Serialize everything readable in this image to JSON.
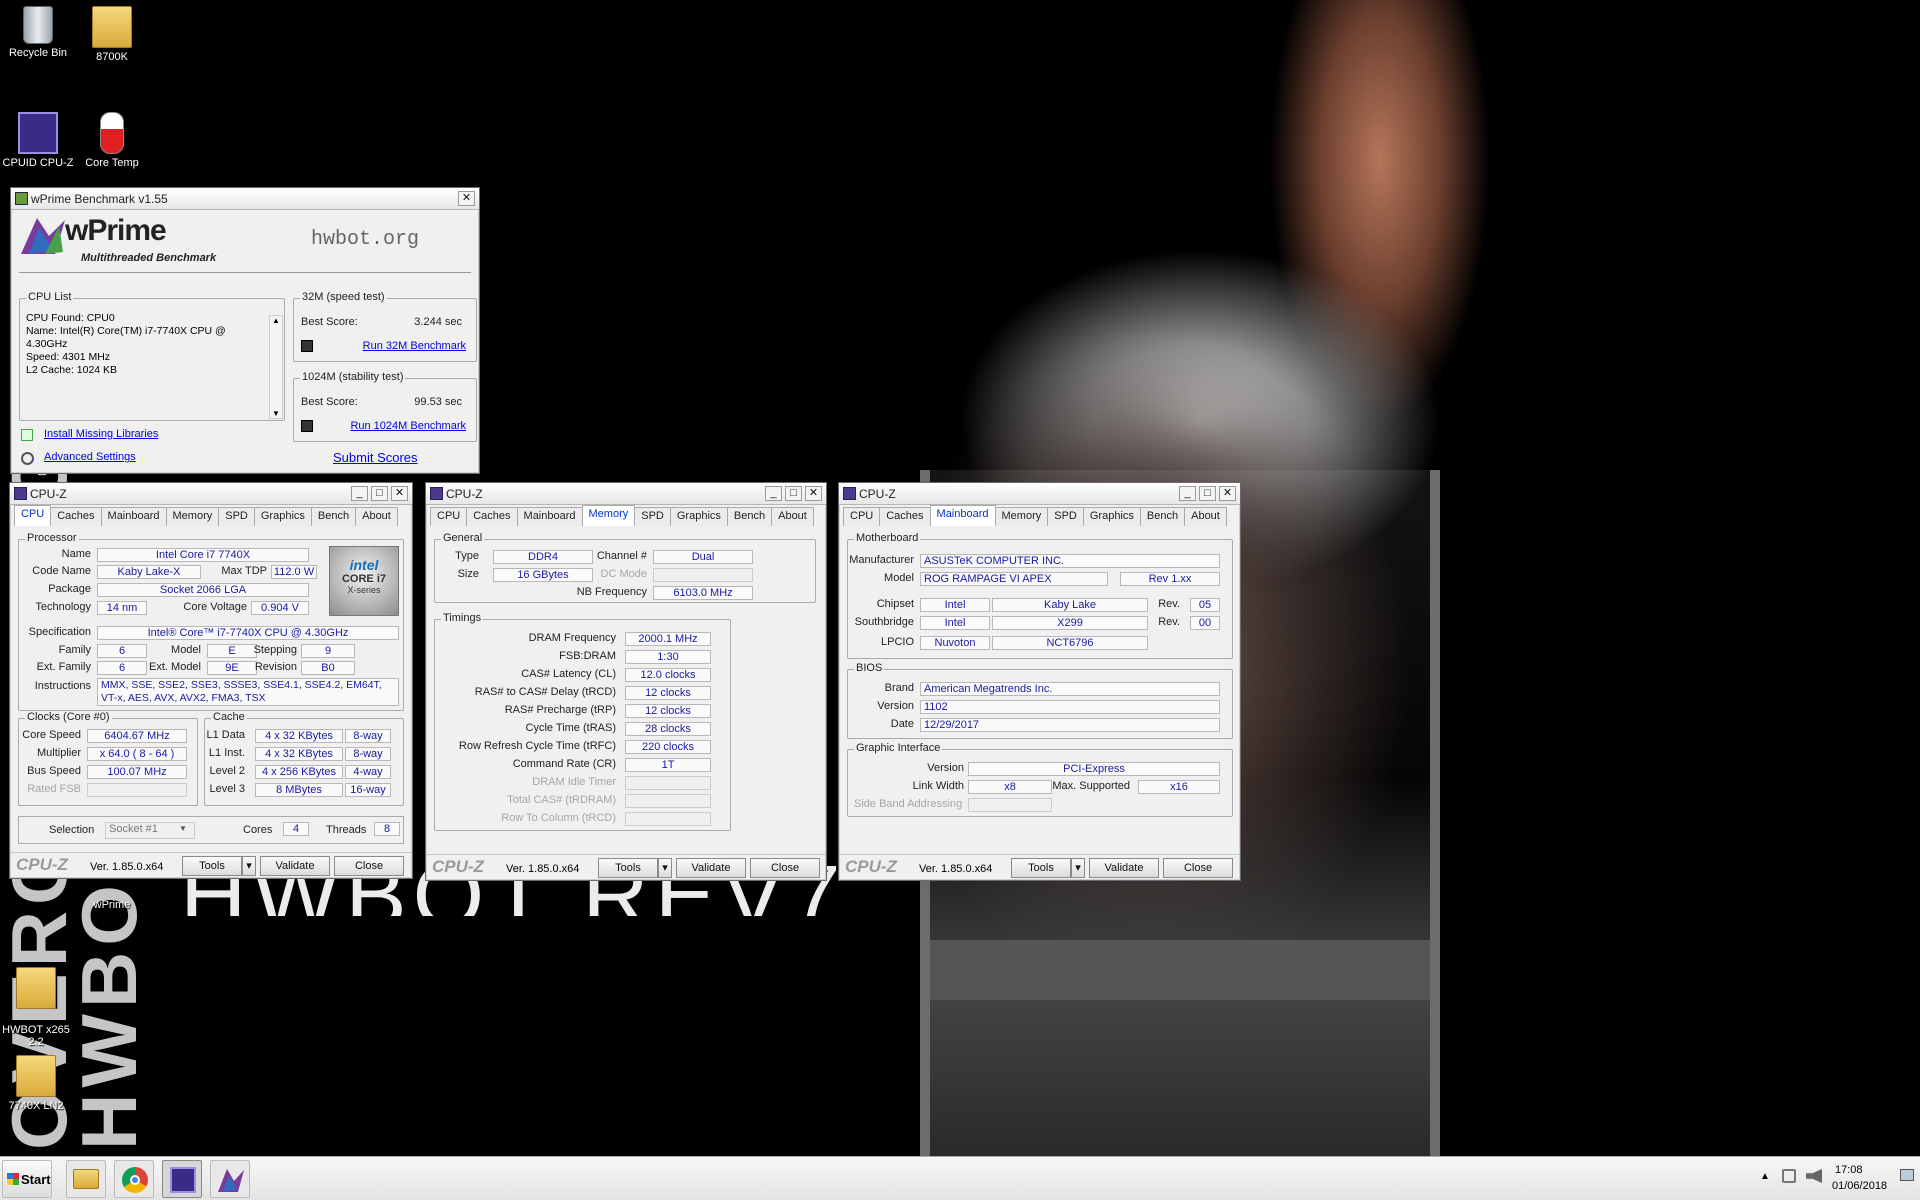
{
  "desktop": {
    "icons": [
      {
        "id": "recycle",
        "label": "Recycle Bin"
      },
      {
        "id": "f8700k",
        "label": "8700K"
      },
      {
        "id": "cpuz",
        "label": "CPUID CPU-Z"
      },
      {
        "id": "coretemp",
        "label": "Core Temp"
      },
      {
        "id": "wprime",
        "label": "wPrime"
      },
      {
        "id": "hwbot",
        "label": "HWBOT x265\n2.2"
      },
      {
        "id": "f7740x",
        "label": "7740X LN2"
      }
    ],
    "wallpaper_text": "HWBOT REV7",
    "side_text": "OVERCLOCKING HWBOT"
  },
  "wprime": {
    "title": "wPrime Benchmark v1.55",
    "logo": "wPrime",
    "logo_sub": "Multithreaded Benchmark",
    "hwbot": "hwbot.org",
    "cpu_list_label": "CPU List",
    "cpu_list_lines": [
      "CPU Found: CPU0",
      "Name:    Intel(R) Core(TM) i7-7740X CPU @",
      "4.30GHz",
      "Speed:   4301 MHz",
      "L2 Cache: 1024 KB"
    ],
    "speed_test_label": "32M (speed test)",
    "stability_test_label": "1024M (stability test)",
    "best_score_label": "Best Score:",
    "score_32m": "3.244 sec",
    "score_1024m": "99.53 sec",
    "run_32m": "Run 32M Benchmark",
    "run_1024m": "Run 1024M Benchmark",
    "install_libs": "Install Missing Libraries",
    "advanced": "Advanced Settings",
    "submit": "Submit Scores"
  },
  "cpuz_common": {
    "title": "CPU-Z",
    "tabs": [
      "CPU",
      "Caches",
      "Mainboard",
      "Memory",
      "SPD",
      "Graphics",
      "Bench",
      "About"
    ],
    "logo": "CPU-Z",
    "version": "Ver. 1.85.0.x64",
    "tools": "Tools",
    "validate": "Validate",
    "close": "Close"
  },
  "cpuz1": {
    "processor_label": "Processor",
    "name_label": "Name",
    "name": "Intel Core i7 7740X",
    "codename_label": "Code Name",
    "codename": "Kaby Lake-X",
    "maxtdp_label": "Max TDP",
    "maxtdp": "112.0 W",
    "package_label": "Package",
    "package": "Socket 2066 LGA",
    "tech_label": "Technology",
    "tech": "14 nm",
    "corevolt_label": "Core Voltage",
    "corevolt": "0.904 V",
    "spec_label": "Specification",
    "spec": "Intel® Core™ i7-7740X CPU @ 4.30GHz",
    "family_label": "Family",
    "family": "6",
    "model_label": "Model",
    "model": "E",
    "stepping_label": "Stepping",
    "stepping": "9",
    "extfamily_label": "Ext. Family",
    "extfamily": "6",
    "extmodel_label": "Ext. Model",
    "extmodel": "9E",
    "revision_label": "Revision",
    "revision": "B0",
    "instr_label": "Instructions",
    "instr": "MMX, SSE, SSE2, SSE3, SSSE3, SSE4.1, SSE4.2, EM64T, VT-x, AES, AVX, AVX2, FMA3, TSX",
    "clocks_label": "Clocks (Core #0)",
    "corespeed_label": "Core Speed",
    "corespeed": "6404.67 MHz",
    "multiplier_label": "Multiplier",
    "multiplier": "x 64.0 ( 8 - 64 )",
    "busspeed_label": "Bus Speed",
    "busspeed": "100.07 MHz",
    "ratedfsb_label": "Rated FSB",
    "cache_label": "Cache",
    "l1d_label": "L1 Data",
    "l1d": "4 x 32 KBytes",
    "l1d_way": "8-way",
    "l1i_label": "L1 Inst.",
    "l1i": "4 x 32 KBytes",
    "l1i_way": "8-way",
    "l2_label": "Level 2",
    "l2": "4 x 256 KBytes",
    "l2_way": "4-way",
    "l3_label": "Level 3",
    "l3": "8 MBytes",
    "l3_way": "16-way",
    "selection_label": "Selection",
    "selection": "Socket #1",
    "cores_label": "Cores",
    "cores": "4",
    "threads_label": "Threads",
    "threads": "8",
    "badge_brand": "intel",
    "badge_line1": "CORE i7",
    "badge_line2": "X-series"
  },
  "cpuz2": {
    "general_label": "General",
    "type_label": "Type",
    "type": "DDR4",
    "channel_label": "Channel #",
    "channel": "Dual",
    "size_label": "Size",
    "size": "16 GBytes",
    "dcmode_label": "DC Mode",
    "nbfreq_label": "NB Frequency",
    "nbfreq": "6103.0 MHz",
    "timings_label": "Timings",
    "rows": [
      {
        "label": "DRAM Frequency",
        "value": "2000.1 MHz",
        "disabled": false
      },
      {
        "label": "FSB:DRAM",
        "value": "1:30",
        "disabled": false
      },
      {
        "label": "CAS# Latency (CL)",
        "value": "12.0 clocks",
        "disabled": false
      },
      {
        "label": "RAS# to CAS# Delay (tRCD)",
        "value": "12 clocks",
        "disabled": false
      },
      {
        "label": "RAS# Precharge (tRP)",
        "value": "12 clocks",
        "disabled": false
      },
      {
        "label": "Cycle Time (tRAS)",
        "value": "28 clocks",
        "disabled": false
      },
      {
        "label": "Row Refresh Cycle Time (tRFC)",
        "value": "220 clocks",
        "disabled": false
      },
      {
        "label": "Command Rate (CR)",
        "value": "1T",
        "disabled": false
      },
      {
        "label": "DRAM Idle Timer",
        "value": "",
        "disabled": true
      },
      {
        "label": "Total CAS# (tRDRAM)",
        "value": "",
        "disabled": true
      },
      {
        "label": "Row To Column (tRCD)",
        "value": "",
        "disabled": true
      }
    ]
  },
  "cpuz3": {
    "motherboard_label": "Motherboard",
    "manufacturer_label": "Manufacturer",
    "manufacturer": "ASUSTeK COMPUTER INC.",
    "model_label": "Model",
    "model": "ROG RAMPAGE VI APEX",
    "model_rev": "Rev 1.xx",
    "chipset_label": "Chipset",
    "chipset_vendor": "Intel",
    "chipset": "Kaby Lake",
    "rev_label": "Rev.",
    "chipset_rev": "05",
    "southbridge_label": "Southbridge",
    "sb_vendor": "Intel",
    "sb": "X299",
    "sb_rev": "00",
    "lpcio_label": "LPCIO",
    "lpcio_vendor": "Nuvoton",
    "lpcio": "NCT6796",
    "bios_label": "BIOS",
    "brand_label": "Brand",
    "brand": "American Megatrends Inc.",
    "version_label": "Version",
    "version": "1102",
    "date_label": "Date",
    "date": "12/29/2017",
    "gi_label": "Graphic Interface",
    "gi_version_label": "Version",
    "gi_version": "PCI-Express",
    "linkwidth_label": "Link Width",
    "linkwidth": "x8",
    "maxsupported_label": "Max. Supported",
    "maxsupported": "x16",
    "sideband_label": "Side Band Addressing"
  },
  "taskbar": {
    "start": "Start",
    "time": "17:08",
    "date": "01/06/2018"
  }
}
